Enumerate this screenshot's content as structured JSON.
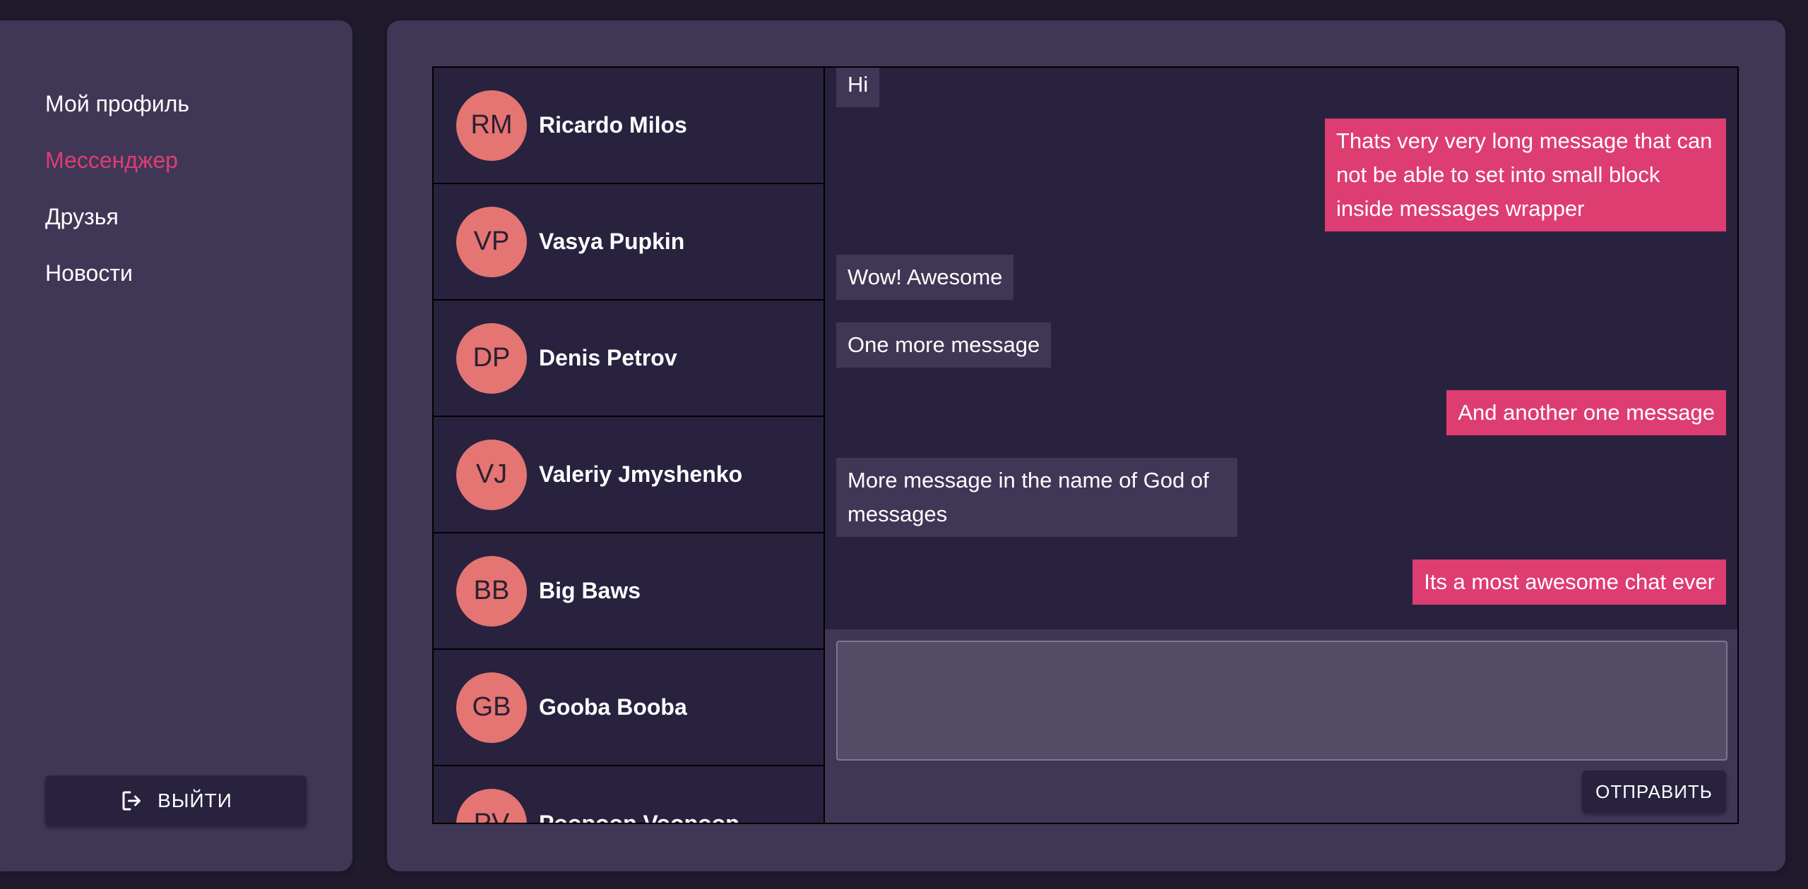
{
  "sidebar": {
    "items": [
      {
        "label": "Мой профиль",
        "active": false
      },
      {
        "label": "Мессенджер",
        "active": true
      },
      {
        "label": "Друзья",
        "active": false
      },
      {
        "label": "Новости",
        "active": false
      }
    ],
    "logout_label": "ВЫЙТИ",
    "logout_icon": "logout-icon"
  },
  "dialogs": [
    {
      "initials": "RM",
      "name": "Ricardo Milos"
    },
    {
      "initials": "VP",
      "name": "Vasya Pupkin"
    },
    {
      "initials": "DP",
      "name": "Denis Petrov"
    },
    {
      "initials": "VJ",
      "name": "Valeriy Jmyshenko"
    },
    {
      "initials": "BB",
      "name": "Big Baws"
    },
    {
      "initials": "GB",
      "name": "Gooba Booba"
    },
    {
      "initials": "PV",
      "name": "Poopoop Voopoop"
    }
  ],
  "messages": [
    {
      "text": "Hi",
      "direction": "incoming"
    },
    {
      "text": "Thats very very long message that can not be able to set into small block inside messages wrapper",
      "direction": "outgoing"
    },
    {
      "text": "Wow! Awesome",
      "direction": "incoming"
    },
    {
      "text": "One more message",
      "direction": "incoming"
    },
    {
      "text": "And another one message",
      "direction": "outgoing"
    },
    {
      "text": "More message in the name of God of messages",
      "direction": "incoming"
    },
    {
      "text": "Its a most awesome chat ever",
      "direction": "outgoing"
    }
  ],
  "composer": {
    "value": "",
    "send_label": "ОТПРАВИТЬ"
  },
  "colors": {
    "background": "#1f1b2d",
    "panel": "#403756",
    "dark": "#29223f",
    "accent": "#de3d72",
    "avatar": "#e47573"
  }
}
